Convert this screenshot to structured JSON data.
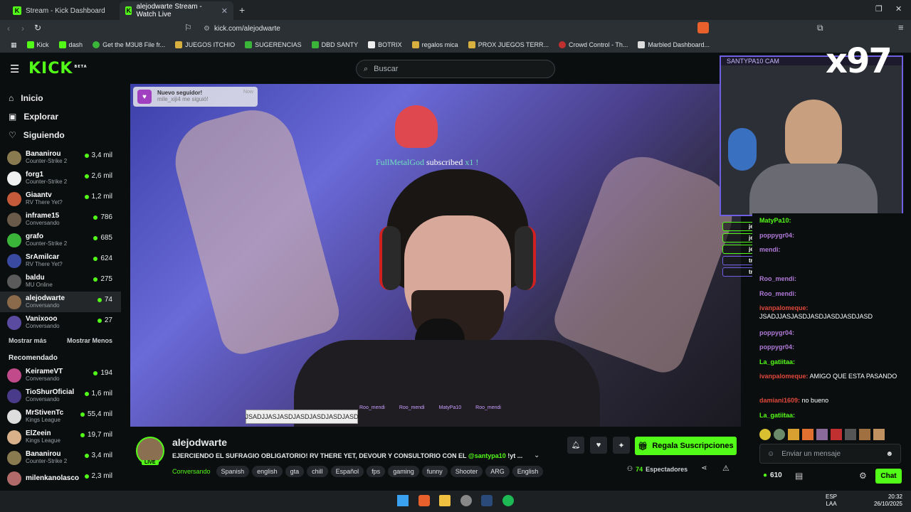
{
  "browser": {
    "tabs": [
      {
        "title": "Stream - Kick Dashboard",
        "active": false
      },
      {
        "title": "alejodwarte Stream - Watch Live",
        "active": true
      }
    ],
    "url": "kick.com/alejodwarte",
    "bookmarks": [
      "Kick",
      "dash",
      "Get the M3U8 File fr...",
      "JUEGOS ITCHIO",
      "SUGERENCIAS",
      "DBD SANTY",
      "BOTRIX",
      "regalos mica",
      "PROX JUEGOS TERR...",
      "Crowd Control - Th...",
      "Marbled Dashboard..."
    ]
  },
  "header": {
    "logo": "KICK",
    "logo_badge": "BETA",
    "search_placeholder": "Buscar"
  },
  "sidebar": {
    "nav": [
      {
        "label": "Inicio",
        "icon": "home-icon"
      },
      {
        "label": "Explorar",
        "icon": "compass-icon"
      },
      {
        "label": "Siguiendo",
        "icon": "heart-icon"
      }
    ],
    "following": [
      {
        "name": "Bananirou",
        "game": "Counter-Strike 2",
        "viewers": "3,4 mil",
        "color": "#8a7a50"
      },
      {
        "name": "forg1",
        "game": "Counter-Strike 2",
        "viewers": "2,6 mil",
        "color": "#f0f0f0"
      },
      {
        "name": "Giaantv",
        "game": "RV There Yet?",
        "viewers": "1,2 mil",
        "color": "#c45a3a"
      },
      {
        "name": "inframe15",
        "game": "Conversando",
        "viewers": "786",
        "color": "#6a5a4a"
      },
      {
        "name": "grafo",
        "game": "Counter-Strike 2",
        "viewers": "685",
        "color": "#3ab53a"
      },
      {
        "name": "SrAmilcar",
        "game": "RV There Yet?",
        "viewers": "624",
        "color": "#3a4aa0"
      },
      {
        "name": "baldu",
        "game": "MU Online",
        "viewers": "275",
        "color": "#5a5a5a"
      },
      {
        "name": "alejodwarte",
        "game": "Conversando",
        "viewers": "74",
        "color": "#8a6a4a"
      },
      {
        "name": "Vanixooo",
        "game": "Conversando",
        "viewers": "27",
        "color": "#5a4aa0"
      }
    ],
    "show_more": "Mostrar más",
    "show_less": "Mostrar Menos",
    "recommended_title": "Recomendado",
    "recommended": [
      {
        "name": "KeirameVT",
        "game": "Conversando",
        "viewers": "194",
        "color": "#c04a8a"
      },
      {
        "name": "TioShurOficial",
        "game": "Conversando",
        "viewers": "1,6 mil",
        "color": "#4a3a8a"
      },
      {
        "name": "MrStivenTc",
        "game": "Kings League",
        "viewers": "55,4 mil",
        "color": "#ddd"
      },
      {
        "name": "ElZeein",
        "game": "Kings League",
        "viewers": "19,7 mil",
        "color": "#d8b08a"
      },
      {
        "name": "Bananirou",
        "game": "Counter-Strike 2",
        "viewers": "3,4 mil",
        "color": "#8a7a50"
      },
      {
        "name": "milenkanolasco",
        "game": "",
        "viewers": "2,3 mil",
        "color": "#b06a6a"
      }
    ]
  },
  "video": {
    "notification_title": "Nuevo seguidor!",
    "notification_body": "mile_xiji4 me siguió!",
    "notification_time": "Now",
    "sub_alert_user": "FullMetalGod",
    "sub_alert_text": "subscribed",
    "sub_alert_count": "x1 !",
    "bottom_chat_text": "JSADJJASJASDJASDJASDJASDJASD",
    "bottom_names": [
      "Roo_mendi",
      "Roo_mendi",
      "MatyPa10",
      "Roo_mendi"
    ]
  },
  "cam": {
    "label": "SANTYPA10 CAM",
    "multiplier": "x97"
  },
  "overlay_chat": [
    {
      "user": "jerrysgr",
      "text": ""
    },
    {
      "user": "jerrysgr",
      "text": ""
    },
    {
      "user": "jerrysgr",
      "text": ""
    },
    {
      "user": "trinopls",
      "text": "https://kick.com/alejodwarte"
    },
    {
      "user": "trinopls",
      "text": "https://kick.com/alejodwarte"
    }
  ],
  "chat": {
    "messages": [
      {
        "user": "MatyPa10",
        "text": "",
        "color": "#53fc18"
      },
      {
        "user": "poppygr04",
        "text": "",
        "color": "#b07ad8"
      },
      {
        "user": "mendi",
        "text": "",
        "color": "#b07ad8"
      },
      {
        "user": "Roo_mendi",
        "text": "",
        "color": "#b07ad8"
      },
      {
        "user": "Roo_mendi",
        "text": "",
        "color": "#b07ad8"
      },
      {
        "user": "ivanpalomeque",
        "text": "JSADJJASJASDJASDJASDJASDJASD",
        "color": "#e0483a"
      },
      {
        "user": "poppygr04",
        "text": "",
        "color": "#b07ad8"
      },
      {
        "user": "poppygr04",
        "text": "",
        "color": "#b07ad8"
      },
      {
        "user": "La_gatiitaa",
        "text": "",
        "color": "#53fc18"
      },
      {
        "user": "ivanpalomeque",
        "text": "AMIGO QUE ESTA PASANDO",
        "color": "#e0483a"
      },
      {
        "user": "damiani1609",
        "text": "no bueno",
        "color": "#e0483a"
      },
      {
        "user": "La_gatiitaa",
        "text": "",
        "color": "#53fc18"
      }
    ],
    "input_placeholder": "Enviar un mensaje",
    "points": "610",
    "send_label": "Chat"
  },
  "channel": {
    "name": "alejodwarte",
    "live_badge": "LIVE",
    "title_start": "EJERCIENDO EL SUFRAGIO OBLIGATORIO! RV THERE YET, DEVOUR Y CONSULTORIO CON EL",
    "title_mention": "@santypa10",
    "title_end": "!yt ...",
    "category": "Conversando",
    "tags": [
      "Spanish",
      "english",
      "gta",
      "chill",
      "Español",
      "fps",
      "gaming",
      "funny",
      "Shooter",
      "ARG",
      "English"
    ],
    "gift_button": "Regala Suscripciones",
    "viewers": "74",
    "viewers_label": "Espectadores"
  },
  "taskbar": {
    "lang": "ESP",
    "lang2": "LAA",
    "time": "20:32",
    "date": "26/10/2025"
  },
  "colors": {
    "kick_green": "#53fc18",
    "bg": "#0b0e0f",
    "purple": "#6f5fe3"
  }
}
